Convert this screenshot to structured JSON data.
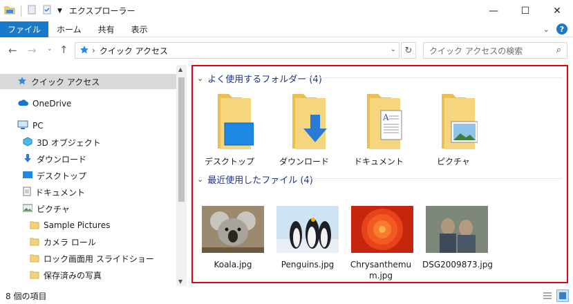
{
  "window": {
    "title": "エクスプローラー",
    "controls": {
      "minimize": "—",
      "maximize": "☐",
      "close": "✕"
    }
  },
  "ribbon": {
    "tabs": [
      "ファイル",
      "ホーム",
      "共有",
      "表示"
    ]
  },
  "addressbar": {
    "path": "クイック アクセス",
    "search_placeholder": "クイック アクセスの検索"
  },
  "sidebar": {
    "quick_access": "クイック アクセス",
    "onedrive": "OneDrive",
    "pc": "PC",
    "items": [
      "3D オブジェクト",
      "ダウンロード",
      "デスクトップ",
      "ドキュメント",
      "ピクチャ"
    ],
    "subitems": [
      "Sample Pictures",
      "カメラ ロール",
      "ロック画面用 スライドショー",
      "保存済みの写真"
    ]
  },
  "content": {
    "frequent_header": "よく使用するフォルダー (4)",
    "frequent": [
      "デスクトップ",
      "ダウンロード",
      "ドキュメント",
      "ピクチャ"
    ],
    "recent_header": "最近使用したファイル (4)",
    "recent": [
      "Koala.jpg",
      "Penguins.jpg",
      "Chrysanthemum.jpg",
      "DSG2009873.jpg"
    ]
  },
  "status": {
    "count": "8 個の項目"
  },
  "colors": {
    "accent": "#1979ca",
    "highlight": "#e60012",
    "group_header": "#1e3287",
    "folder": "#f3d37a"
  }
}
